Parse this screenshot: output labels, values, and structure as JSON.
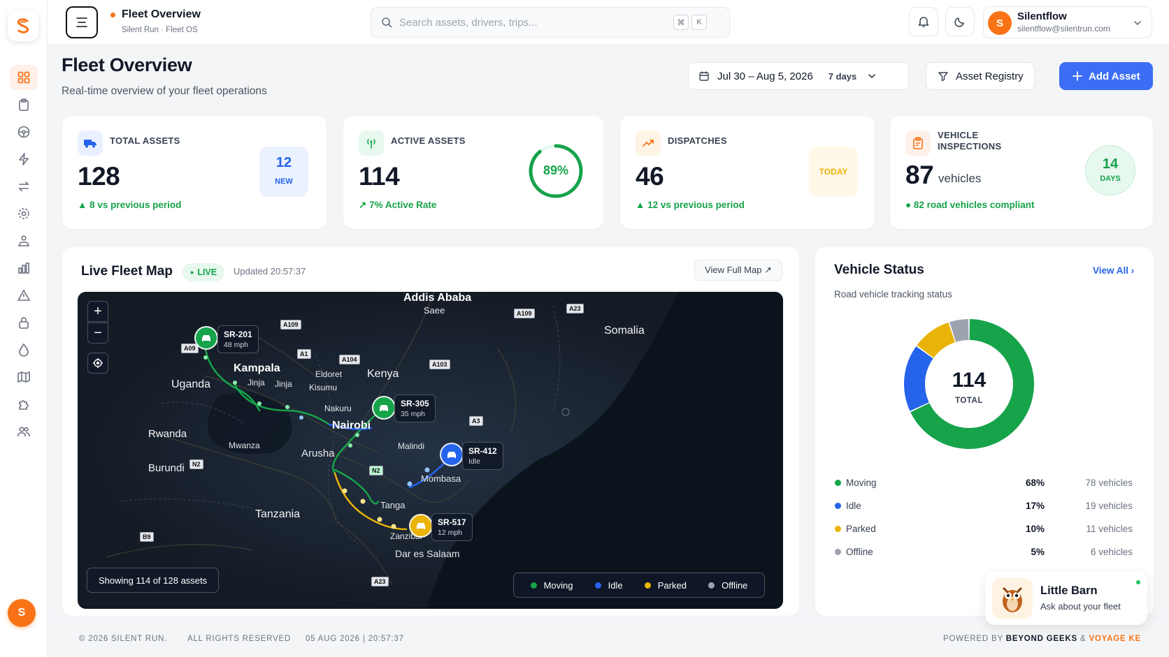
{
  "sidebar": {
    "items": [
      {
        "icon": "dashboard-grid-icon",
        "active": true
      },
      {
        "icon": "clipboard-icon"
      },
      {
        "icon": "steering-wheel-icon"
      },
      {
        "icon": "lightning-icon"
      },
      {
        "icon": "transfer-arrows-icon"
      },
      {
        "icon": "settings-gear-icon"
      },
      {
        "icon": "users-network-icon"
      },
      {
        "icon": "bar-chart-icon"
      },
      {
        "icon": "warning-triangle-icon"
      },
      {
        "icon": "lock-icon"
      },
      {
        "icon": "fuel-drop-icon"
      },
      {
        "icon": "map-book-icon"
      },
      {
        "icon": "puzzle-icon"
      },
      {
        "icon": "team-icon"
      }
    ],
    "avatar": "S"
  },
  "topbar": {
    "title": "Fleet Overview",
    "subtitle": "Silent Run · Fleet OS",
    "search_placeholder": "Search assets, drivers, trips...",
    "shortcut_cmd": "⌘",
    "shortcut_key": "K",
    "user": {
      "initial": "S",
      "name": "Silentflow",
      "email": "silentflow@silentrun.com"
    }
  },
  "header": {
    "title": "Fleet Overview",
    "subtitle": "Real-time overview of your fleet operations",
    "date_range": "Jul 30 – Aug 5, 2026",
    "period": "7 days",
    "registry_label": "Asset Registry",
    "add_label": "Add Asset"
  },
  "kpis": {
    "total": {
      "label": "TOTAL ASSETS",
      "value": "128",
      "badge_value": "12",
      "badge_label": "NEW",
      "foot": "8 vs previous period"
    },
    "active": {
      "label": "ACTIVE ASSETS",
      "value": "114",
      "ring_pct": 89,
      "ring_label": "89%",
      "foot": "7% Active Rate"
    },
    "dispatches": {
      "label": "DISPATCHES",
      "value": "46",
      "badge_label": "TODAY",
      "foot": "12 vs previous period"
    },
    "inspections": {
      "label_1": "VEHICLE",
      "label_2": "INSPECTIONS",
      "value": "87",
      "unit": "vehicles",
      "badge_value": "14",
      "badge_label": "DAYS",
      "foot": "82 road vehicles compliant"
    }
  },
  "map": {
    "title": "Live Fleet Map",
    "live": "LIVE",
    "updated": "Updated 20:57:37",
    "view_full": "View Full Map ↗",
    "count": "Showing 114 of 128 assets",
    "places": {
      "addis": "Addis Ababa",
      "saee": "Saee",
      "somalia": "Somalia",
      "kenya": "Kenya",
      "uganda": "Uganda",
      "kampala": "Kampala",
      "jinja1": "Jinja",
      "jinja2": "Jinja",
      "eldoret": "Eldoret",
      "kisumu": "Kisumu",
      "nakuru": "Nakuru",
      "nairobi": "Nairobi",
      "rwanda": "Rwanda",
      "burundi": "Burundi",
      "mwanza": "Mwanza",
      "arusha": "Arusha",
      "malindi": "Malindi",
      "mombasa": "Mombasa",
      "tanga": "Tanga",
      "tanzania": "Tanzania",
      "zanzibar": "Zanzibar",
      "dar": "Dar es Salaam"
    },
    "roads": {
      "a109a": "A109",
      "a109b": "A109",
      "a23a": "A23",
      "a23b": "A23",
      "a09": "A09",
      "a1": "A1",
      "a104": "A104",
      "a103": "A103",
      "a3": "A3",
      "n2a": "N2",
      "n2b": "N2",
      "b9": "B9"
    },
    "vehicles": [
      {
        "id": "SR-201",
        "info": "48 mph",
        "color": "#16a34a"
      },
      {
        "id": "SR-305",
        "info": "35 mph",
        "color": "#16a34a"
      },
      {
        "id": "SR-412",
        "info": "Idle",
        "color": "#2563eb"
      },
      {
        "id": "SR-517",
        "info": "12 mph",
        "color": "#eab308"
      }
    ],
    "legend": [
      "Moving",
      "Idle",
      "Parked",
      "Offline"
    ]
  },
  "status": {
    "title": "Vehicle Status",
    "view_all": "View All ›",
    "subtitle": "Road vehicle tracking status",
    "total_value": "114",
    "total_label": "TOTAL",
    "rows": [
      {
        "name": "Moving",
        "pct": "68%",
        "count": "78 vehicles",
        "color": "#16a34a",
        "share": 68
      },
      {
        "name": "Idle",
        "pct": "17%",
        "count": "19 vehicles",
        "color": "#2563eb",
        "share": 17
      },
      {
        "name": "Parked",
        "pct": "10%",
        "count": "11 vehicles",
        "color": "#eab308",
        "share": 10
      },
      {
        "name": "Offline",
        "pct": "5%",
        "count": "6 vehicles",
        "color": "#9ca3af",
        "share": 5
      }
    ]
  },
  "assistant": {
    "name": "Little Barn",
    "subtitle": "Ask about your fleet"
  },
  "footer": {
    "copyright": "© 2026 SILENT RUN.",
    "rights": "ALL RIGHTS RESERVED",
    "timestamp": "05 AUG 2026 | 20:57:37",
    "powered_prefix": "POWERED BY",
    "powered_a": "BEYOND GEEKS",
    "amp": "&",
    "powered_b": "VOYAGE KE"
  },
  "colors": {
    "brand": "#f97316",
    "accent": "#3b6ef5",
    "moving": "#16a34a",
    "idle": "#2563eb",
    "parked": "#eab308",
    "offline": "#9ca3af"
  }
}
